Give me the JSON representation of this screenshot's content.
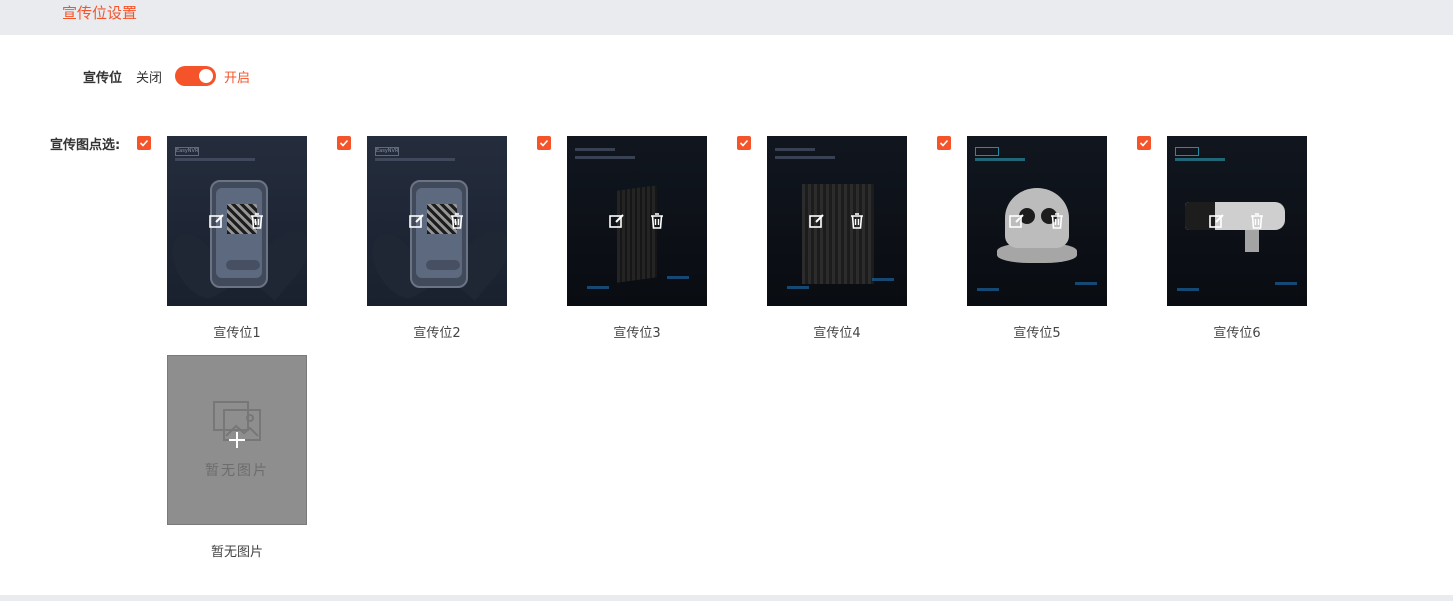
{
  "header": {
    "title": "宣传位设置"
  },
  "ad_toggle": {
    "label": "宣传位",
    "off_label": "关闭",
    "on_label": "开启",
    "enabled": true
  },
  "images": {
    "label": "宣传图点选:",
    "items": [
      {
        "caption": "宣传位1",
        "checked": true,
        "tag": "EasyNVR",
        "style": "phone"
      },
      {
        "caption": "宣传位2",
        "checked": true,
        "tag": "EasyNVR",
        "style": "phone"
      },
      {
        "caption": "宣传位3",
        "checked": true,
        "tag": "EasyNVS云存储",
        "style": "nvr"
      },
      {
        "caption": "宣传位4",
        "checked": true,
        "tag": "EasyNTS云组网",
        "style": "nts"
      },
      {
        "caption": "宣传位5",
        "checked": true,
        "tag": "海康威视",
        "style": "dome"
      },
      {
        "caption": "宣传位6",
        "checked": true,
        "tag": "海康威视",
        "style": "bullet"
      }
    ],
    "empty": {
      "placeholder": "暂无图片",
      "caption": "暂无图片"
    }
  },
  "icons": {
    "edit": "edit-icon",
    "delete": "trash-icon",
    "add": "plus-icon",
    "image": "image-icon",
    "check": "check-icon"
  },
  "colors": {
    "accent": "#f5542a",
    "topbar": "#e9ebef",
    "placeholder_bg": "#8e8e8e"
  }
}
